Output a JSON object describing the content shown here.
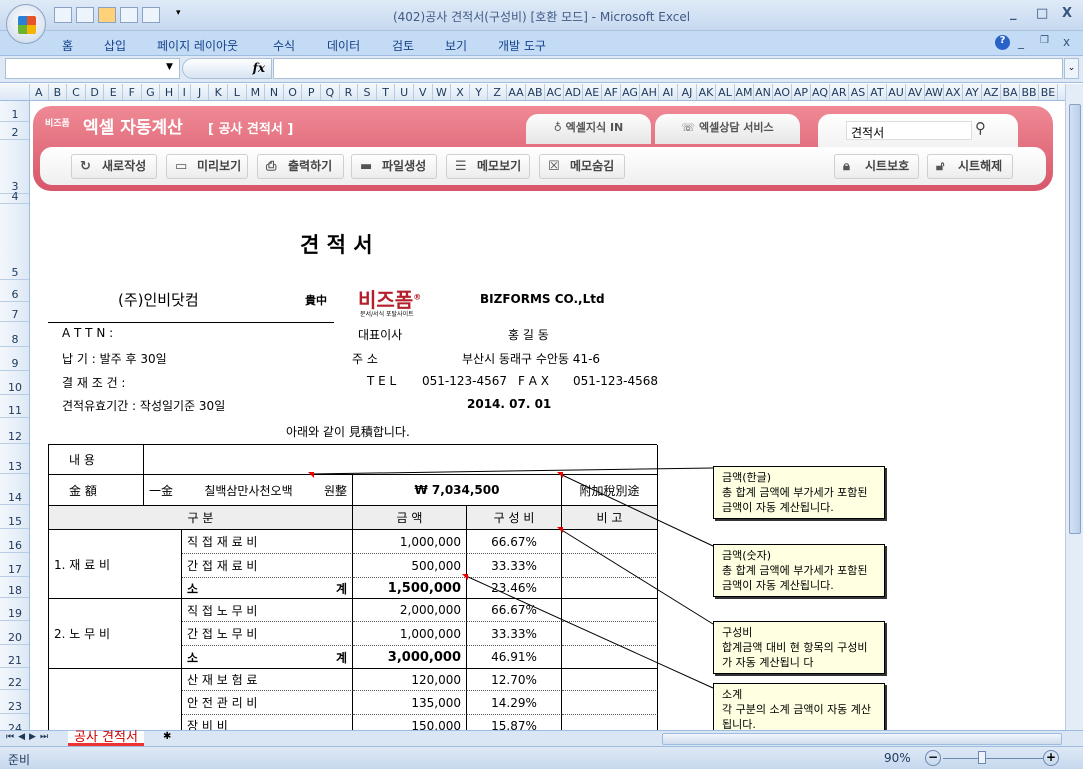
{
  "window": {
    "title": "(402)공사 견적서(구성비)  [호환 모드] - Microsoft Excel",
    "min": "_",
    "max": "□",
    "close": "X"
  },
  "ribbon": {
    "tabs": [
      "홈",
      "삽입",
      "페이지 레이아웃",
      "수식",
      "데이터",
      "검토",
      "보기",
      "개발 도구"
    ],
    "help": "?"
  },
  "formula_bar": {
    "fx": "fx",
    "name_box": "",
    "formula": ""
  },
  "columns": [
    "A",
    "B",
    "C",
    "D",
    "E",
    "F",
    "G",
    "H",
    "I",
    "J",
    "K",
    "L",
    "M",
    "N",
    "O",
    "P",
    "Q",
    "R",
    "S",
    "T",
    "U",
    "V",
    "W",
    "X",
    "Y",
    "Z",
    "AA",
    "AB",
    "AC",
    "AD",
    "AE",
    "AF",
    "AG",
    "AH",
    "AI",
    "AJ",
    "AK",
    "AL",
    "AM",
    "AN",
    "AO",
    "AP",
    "AQ",
    "AR",
    "AS",
    "AT",
    "AU",
    "AV",
    "AW",
    "AX",
    "AY",
    "AZ",
    "BA",
    "BB",
    "BE"
  ],
  "rows": [
    "1",
    "2",
    "3",
    "4",
    "5",
    "6",
    "7",
    "8",
    "9",
    "10",
    "11",
    "12",
    "13",
    "14",
    "15",
    "16",
    "17",
    "18",
    "19",
    "20",
    "21",
    "22",
    "23",
    "24"
  ],
  "banner": {
    "brand_small": "비즈폼",
    "brand": "엑셀 자동계산",
    "doc_title": "[ 공사 견적서 ]",
    "tab1": "엑셀지식 IN",
    "tab2": "엑셀상담 서비스",
    "search_value": "견적서",
    "buttons": [
      {
        "label": "새로작성",
        "icon": "refresh-icon"
      },
      {
        "label": "미리보기",
        "icon": "monitor-icon"
      },
      {
        "label": "출력하기",
        "icon": "print-icon"
      },
      {
        "label": "파일생성",
        "icon": "folder-icon"
      },
      {
        "label": "메모보기",
        "icon": "memo-icon"
      },
      {
        "label": "메모숨김",
        "icon": "memo-hide-icon"
      }
    ],
    "protect": "시트보호",
    "unprotect": "시트해제",
    "accent": "#d7566a"
  },
  "doc": {
    "title": "견 적 서",
    "recipient": "(주)인비닷컴",
    "honorific": "貴中",
    "logo_text": "비즈폼",
    "logo_sub": "문서/서식 포탈사이트",
    "company": "BIZFORMS CO.,Ltd",
    "attn": "A T T N :",
    "delivery": "납          기 : 발주 후 30일",
    "payment": "결 재  조 건 :",
    "validity": "견적유효기간 : 작성일기준 30일",
    "ceo_label": "대표이사",
    "ceo": "홍 길 동",
    "addr_label": "주   소",
    "addr": "부산시 동래구 수안동 41-6",
    "tel_label": "T E L",
    "tel": "051-123-4567",
    "fax_label": "F A X",
    "fax": "051-123-4568",
    "date": "2014. 07. 01",
    "intro": "아래와 같이 見積합니다.",
    "content_label": "내          용",
    "amount_label": "金          額",
    "amount_prefix": "一金",
    "amount_korean": "칠백삼만사천오백",
    "amount_suffix": "원整",
    "amount_number": "₩ 7,034,500",
    "vat_note": "附加稅別途",
    "headers": [
      "구                    분",
      "금          액",
      "구 성 비",
      "비          고"
    ],
    "groups": [
      {
        "name": "1.     재     료     비",
        "items": [
          {
            "item": "직    접    재    료    비",
            "amount": "1,000,000",
            "pct": "66.67%"
          },
          {
            "item": "간    접    재    료    비",
            "amount": "500,000",
            "pct": "33.33%"
          },
          {
            "item_l": "소",
            "item_r": "계",
            "amount": "1,500,000",
            "pct": "23.46%",
            "subtotal": true
          }
        ]
      },
      {
        "name": "2.     노     무     비",
        "items": [
          {
            "item": "직    접    노    무    비",
            "amount": "2,000,000",
            "pct": "66.67%"
          },
          {
            "item": "간    접    노    무    비",
            "amount": "1,000,000",
            "pct": "33.33%"
          },
          {
            "item_l": "소",
            "item_r": "계",
            "amount": "3,000,000",
            "pct": "46.91%",
            "subtotal": true
          }
        ]
      },
      {
        "name": "",
        "items": [
          {
            "item": "산    재    보    험    료",
            "amount": "120,000",
            "pct": "12.70%"
          },
          {
            "item": "안    전    관    리    비",
            "amount": "135,000",
            "pct": "14.29%"
          },
          {
            "item": "장              비              비",
            "amount": "150,000",
            "pct": "15.87%"
          }
        ]
      }
    ]
  },
  "comments": [
    {
      "title": "금액(한글)",
      "body": "총 합계 금액에 부가세가\n포함된 금액이\n자동 계산됩니다."
    },
    {
      "title": "금액(숫자)",
      "body": "총 합계 금액에 부가세가\n포함된 금액이\n자동 계산됩니다."
    },
    {
      "title": "구성비",
      "body": " 합계금액 대비 현 항목의\n 구성비가 자동 계산됩니\n다"
    },
    {
      "title": "소계",
      "body": " 각 구분의 소계 금액이\n 자동 계산됩니다."
    }
  ],
  "sheet_tabs": [
    "공사 견적서"
  ],
  "status": {
    "ready": "준비",
    "zoom": "90%",
    "zoom_level": 90
  }
}
